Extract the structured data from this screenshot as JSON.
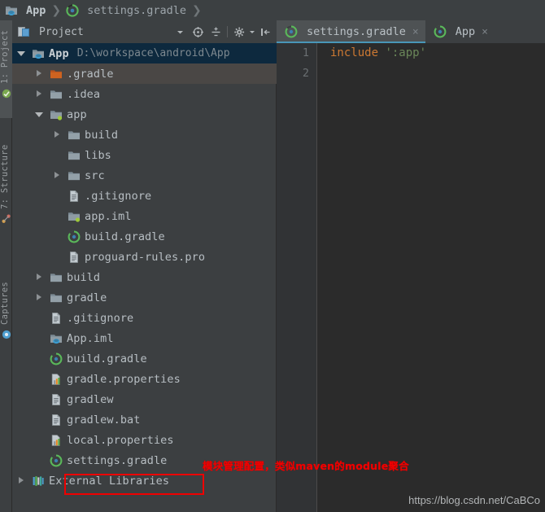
{
  "breadcrumb": {
    "items": [
      {
        "label": "App",
        "icon": "module-folder-icon",
        "bold": true
      },
      {
        "label": "settings.gradle",
        "icon": "gradle-icon",
        "bold": false
      }
    ],
    "separator": "❯"
  },
  "left_strip": {
    "buttons": [
      {
        "label": "1: Project",
        "icon": "project-icon"
      },
      {
        "label": "7: Structure",
        "icon": "structure-icon"
      },
      {
        "label": "Captures",
        "icon": "captures-icon"
      }
    ]
  },
  "project_panel": {
    "title": "Project",
    "title_icon": "project-view-icon",
    "toolbar": [
      {
        "name": "view-mode-dropdown",
        "icon": "chevron-down-icon"
      },
      {
        "name": "scroll-from-source",
        "icon": "target-icon"
      },
      {
        "name": "collapse-all",
        "icon": "collapse-all-icon"
      },
      {
        "name": "settings",
        "icon": "gear-icon"
      },
      {
        "name": "hide-panel",
        "icon": "hide-panel-icon"
      }
    ],
    "tree": [
      {
        "label": "App",
        "path": "D:\\workspace\\android\\App",
        "icon": "module-folder-icon",
        "arrow": "down",
        "indent": 0,
        "state": "selected",
        "bold": true
      },
      {
        "label": ".gradle",
        "path": "",
        "icon": "orange-folder-icon",
        "arrow": "right",
        "indent": 1,
        "state": "hover",
        "bold": false
      },
      {
        "label": ".idea",
        "path": "",
        "icon": "folder-icon",
        "arrow": "right",
        "indent": 1,
        "state": "",
        "bold": false
      },
      {
        "label": "app",
        "path": "",
        "icon": "module-green-folder-icon",
        "arrow": "down",
        "indent": 1,
        "state": "",
        "bold": false
      },
      {
        "label": "build",
        "path": "",
        "icon": "folder-icon",
        "arrow": "right",
        "indent": 2,
        "state": "",
        "bold": false
      },
      {
        "label": "libs",
        "path": "",
        "icon": "folder-icon",
        "arrow": "none",
        "indent": 2,
        "state": "",
        "bold": false
      },
      {
        "label": "src",
        "path": "",
        "icon": "folder-icon",
        "arrow": "right",
        "indent": 2,
        "state": "",
        "bold": false
      },
      {
        "label": ".gitignore",
        "path": "",
        "icon": "text-file-icon",
        "arrow": "none",
        "indent": 2,
        "state": "",
        "bold": false
      },
      {
        "label": "app.iml",
        "path": "",
        "icon": "module-green-folder-icon",
        "arrow": "none",
        "indent": 2,
        "state": "",
        "bold": false
      },
      {
        "label": "build.gradle",
        "path": "",
        "icon": "gradle-icon",
        "arrow": "none",
        "indent": 2,
        "state": "",
        "bold": false
      },
      {
        "label": "proguard-rules.pro",
        "path": "",
        "icon": "text-file-icon",
        "arrow": "none",
        "indent": 2,
        "state": "",
        "bold": false
      },
      {
        "label": "build",
        "path": "",
        "icon": "folder-icon",
        "arrow": "right",
        "indent": 1,
        "state": "",
        "bold": false
      },
      {
        "label": "gradle",
        "path": "",
        "icon": "folder-icon",
        "arrow": "right",
        "indent": 1,
        "state": "",
        "bold": false
      },
      {
        "label": ".gitignore",
        "path": "",
        "icon": "text-file-icon",
        "arrow": "none",
        "indent": 1,
        "state": "",
        "bold": false
      },
      {
        "label": "App.iml",
        "path": "",
        "icon": "module-folder-icon",
        "arrow": "none",
        "indent": 1,
        "state": "",
        "bold": false
      },
      {
        "label": "build.gradle",
        "path": "",
        "icon": "gradle-icon",
        "arrow": "none",
        "indent": 1,
        "state": "",
        "bold": false
      },
      {
        "label": "gradle.properties",
        "path": "",
        "icon": "properties-file-icon",
        "arrow": "none",
        "indent": 1,
        "state": "",
        "bold": false
      },
      {
        "label": "gradlew",
        "path": "",
        "icon": "text-file-icon",
        "arrow": "none",
        "indent": 1,
        "state": "",
        "bold": false
      },
      {
        "label": "gradlew.bat",
        "path": "",
        "icon": "text-file-icon",
        "arrow": "none",
        "indent": 1,
        "state": "",
        "bold": false
      },
      {
        "label": "local.properties",
        "path": "",
        "icon": "properties-file-icon",
        "arrow": "none",
        "indent": 1,
        "state": "",
        "bold": false
      },
      {
        "label": "settings.gradle",
        "path": "",
        "icon": "gradle-icon",
        "arrow": "none",
        "indent": 1,
        "state": "",
        "bold": false
      },
      {
        "label": "External Libraries",
        "path": "",
        "icon": "external-libraries-icon",
        "arrow": "right",
        "indent": 0,
        "state": "",
        "bold": false
      }
    ]
  },
  "annotation": {
    "text": "模块管理配置，类似maven的module聚合",
    "color": "#f00000"
  },
  "editor": {
    "tabs": [
      {
        "label": "settings.gradle",
        "icon": "gradle-icon",
        "active": true,
        "close": "×"
      },
      {
        "label": "App",
        "icon": "gradle-icon",
        "active": false,
        "close": "×"
      }
    ],
    "line_numbers": [
      "1",
      "2"
    ],
    "code": {
      "keyword": "include",
      "string": "':app'"
    },
    "accent_color": "#4996b8"
  },
  "watermark": {
    "text": "https://blog.csdn.net/CaBCo"
  }
}
